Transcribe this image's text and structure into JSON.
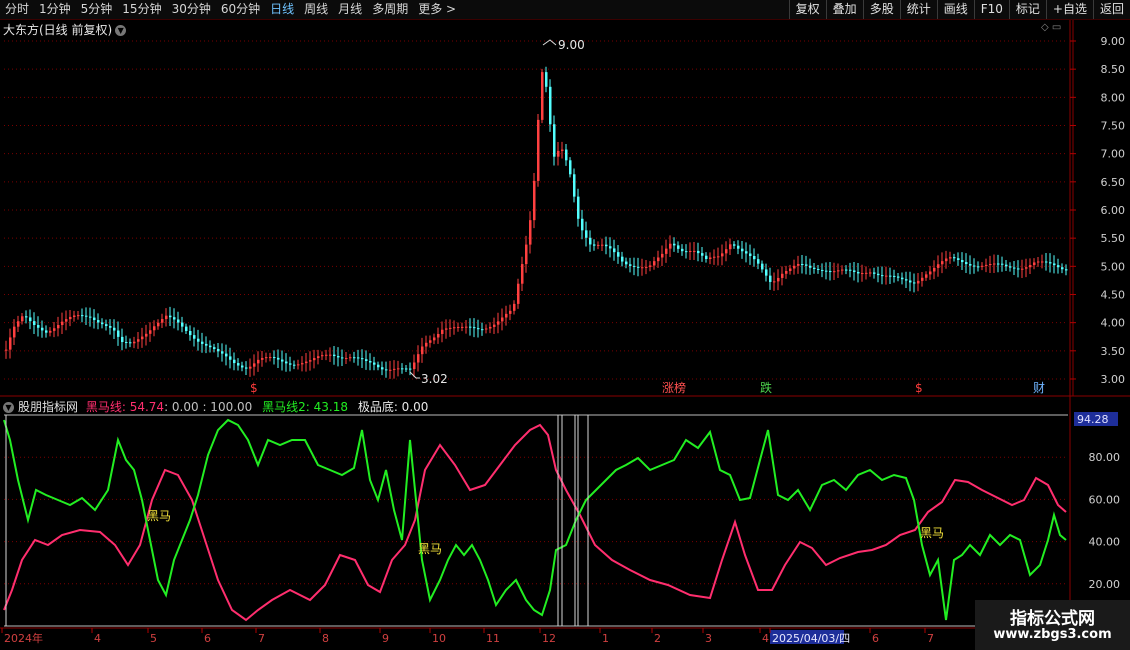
{
  "toolbar": {
    "periods": [
      "分时",
      "1分钟",
      "5分钟",
      "15分钟",
      "30分钟",
      "60分钟",
      "日线",
      "周线",
      "月线",
      "多周期",
      "更多 >"
    ],
    "active_period": "日线",
    "tools": [
      "复权",
      "叠加",
      "多股",
      "统计",
      "画线",
      "F10",
      "标记",
      "+自选",
      "返回"
    ]
  },
  "stock_title": "大东方(日线 前复权)",
  "price_axis": [
    "9.00",
    "8.50",
    "8.00",
    "7.50",
    "7.00",
    "6.50",
    "6.00",
    "5.50",
    "5.00",
    "4.50",
    "4.00",
    "3.50",
    "3.00"
  ],
  "price_annotations": {
    "high": "9.00",
    "low": "3.02"
  },
  "event_markers": [
    {
      "text": "$",
      "color": "#ff3c3c"
    },
    {
      "text": "涨榜",
      "color": "#ff5050"
    },
    {
      "text": "跌",
      "color": "#4cd14c"
    },
    {
      "text": "$",
      "color": "#ff3c3c"
    },
    {
      "text": "财",
      "color": "#6fb4ff"
    }
  ],
  "indicator": {
    "name": "股朋指标网",
    "line1_label": "黑马线: 54.74",
    "range_text": ": 0.00 : 100.00",
    "line2_label": "黑马线2: 43.18",
    "line3_label": "极品底: 0.00",
    "axis": [
      "80.00",
      "60.00",
      "40.00",
      "20.00"
    ],
    "top_value": "94.28",
    "signal_label": "黑马"
  },
  "date_axis": [
    "2024年",
    "4",
    "5",
    "6",
    "7",
    "8",
    "9",
    "10",
    "11",
    "12",
    "1",
    "2",
    "3",
    "4",
    "2025/04/03/四",
    "6",
    "7"
  ],
  "watermark": {
    "title": "指标公式网",
    "url": "www.zbgs3.com"
  },
  "colors": {
    "up": "#ff4040",
    "down": "#54ffff",
    "line1": "#ff2e6e",
    "line2": "#22ee22",
    "grid": "#7a0000"
  }
}
